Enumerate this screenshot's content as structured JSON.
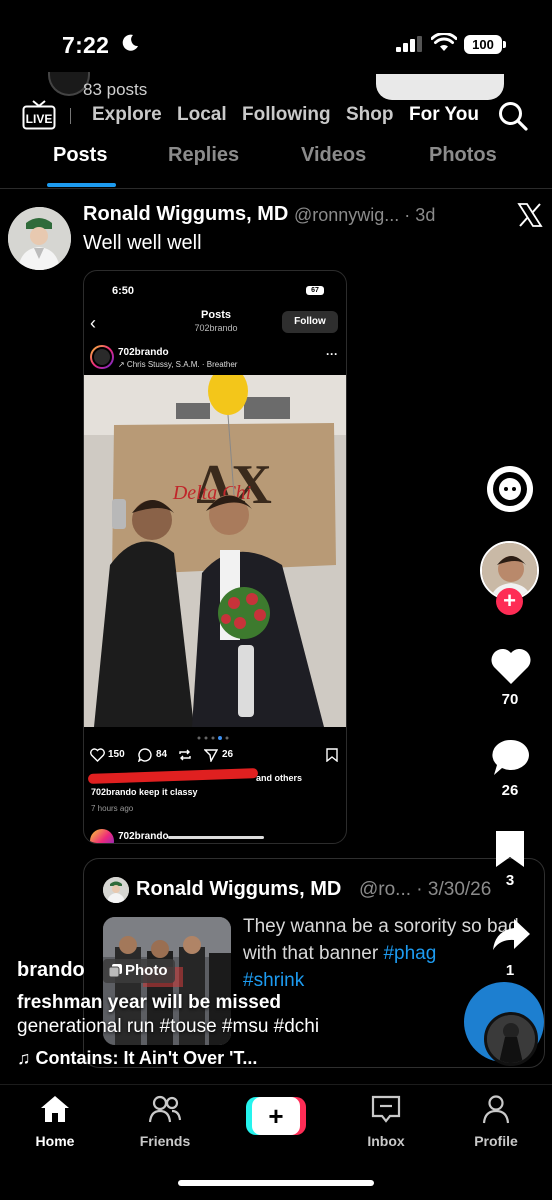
{
  "status_bar": {
    "time": "7:22",
    "battery": "100"
  },
  "header": {
    "posts_count": "83 posts",
    "nav": [
      "Explore",
      "Local",
      "Following",
      "Shop",
      "For You"
    ],
    "live_label": "LIVE"
  },
  "profile_tabs": [
    "Posts",
    "Replies",
    "Videos",
    "Photos"
  ],
  "tweet": {
    "name": "Ronald Wiggums, MD",
    "handle_time": "@ronnywig... · 3d",
    "text": "Well well well"
  },
  "embedded_ig": {
    "time": "6:50",
    "battery": "67",
    "title": "Posts",
    "subtitle": "702brando",
    "follow_label": "Follow",
    "user": "702brando",
    "audio": "↗ Chris Stussy, S.A.M. · Breather",
    "banner_text": "Delta Chi",
    "likes": "150",
    "comments": "84",
    "shares": "26",
    "liked_by_suffix": "and others",
    "caption": "702brando keep it classy",
    "time_ago": "7 hours ago",
    "next_user": "702brando"
  },
  "quoted_tweet": {
    "name": "Ronald Wiggums, MD",
    "handle_time": "@ro... · 3/30/26",
    "text_before": "They wanna be a sorority so bad with that banner ",
    "hashtag1": "#phag",
    "hashtag2": "#shrink"
  },
  "right_rail": {
    "likes": "70",
    "comments": "26",
    "saves": "3",
    "shares": "1"
  },
  "tiktok_caption": {
    "username": "brando",
    "photo_badge": "Photo",
    "line1": "freshman year will be missed",
    "line2": "generational run #touse #msu #dchi",
    "music": "Contains: It Ain't Over 'T..."
  },
  "tab_bar": [
    "Home",
    "Friends",
    "Inbox",
    "Profile"
  ],
  "colors": {
    "x_blue": "#1d9bf0",
    "tiktok_red": "#fe2c55",
    "tiktok_cyan": "#25f4ee"
  }
}
